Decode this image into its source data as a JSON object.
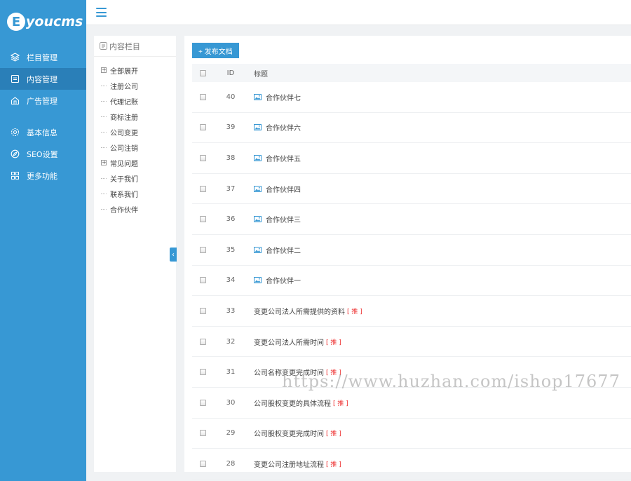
{
  "brand": {
    "letter": "E",
    "name": "youcms"
  },
  "sidebar": {
    "items": [
      {
        "label": "栏目管理",
        "icon": "layers-icon"
      },
      {
        "label": "内容管理",
        "icon": "document-icon",
        "active": true
      },
      {
        "label": "广告管理",
        "icon": "ad-icon"
      },
      {
        "label": "基本信息",
        "icon": "gear-icon"
      },
      {
        "label": "SEO设置",
        "icon": "compass-icon"
      },
      {
        "label": "更多功能",
        "icon": "grid-icon"
      }
    ]
  },
  "tree": {
    "title": "内容栏目",
    "nodes": [
      {
        "label": "全部展开",
        "toggle": "+"
      },
      {
        "label": "注册公司"
      },
      {
        "label": "代理记账"
      },
      {
        "label": "商标注册"
      },
      {
        "label": "公司变更"
      },
      {
        "label": "公司注销"
      },
      {
        "label": "常见问题",
        "toggle": "+"
      },
      {
        "label": "关于我们"
      },
      {
        "label": "联系我们"
      },
      {
        "label": "合作伙伴"
      }
    ],
    "collapse_glyph": "‹"
  },
  "toolbar": {
    "publish_label": "+ 发布文档"
  },
  "table": {
    "headers": {
      "id": "ID",
      "title": "标题"
    },
    "rows": [
      {
        "id": "40",
        "title": "合作伙伴七",
        "image": true
      },
      {
        "id": "39",
        "title": "合作伙伴六",
        "image": true
      },
      {
        "id": "38",
        "title": "合作伙伴五",
        "image": true
      },
      {
        "id": "37",
        "title": "合作伙伴四",
        "image": true
      },
      {
        "id": "36",
        "title": "合作伙伴三",
        "image": true
      },
      {
        "id": "35",
        "title": "合作伙伴二",
        "image": true
      },
      {
        "id": "34",
        "title": "合作伙伴一",
        "image": true
      },
      {
        "id": "33",
        "title": "变更公司法人所需提供的资料",
        "tag": "[ 推 ]"
      },
      {
        "id": "32",
        "title": "变更公司法人所需时间",
        "tag": "[ 推 ]"
      },
      {
        "id": "31",
        "title": "公司名称变更完成时间",
        "tag": "[ 推 ]"
      },
      {
        "id": "30",
        "title": "公司股权变更的具体流程",
        "tag": "[ 推 ]"
      },
      {
        "id": "29",
        "title": "公司股权变更完成时间",
        "tag": "[ 推 ]"
      },
      {
        "id": "28",
        "title": "变更公司注册地址流程",
        "tag": "[ 推 ]"
      }
    ]
  },
  "watermark": "https://www.huzhan.com/ishop17677",
  "colors": {
    "accent": "#3798d4",
    "active": "#2a7fb8",
    "tag": "#ee3333"
  }
}
